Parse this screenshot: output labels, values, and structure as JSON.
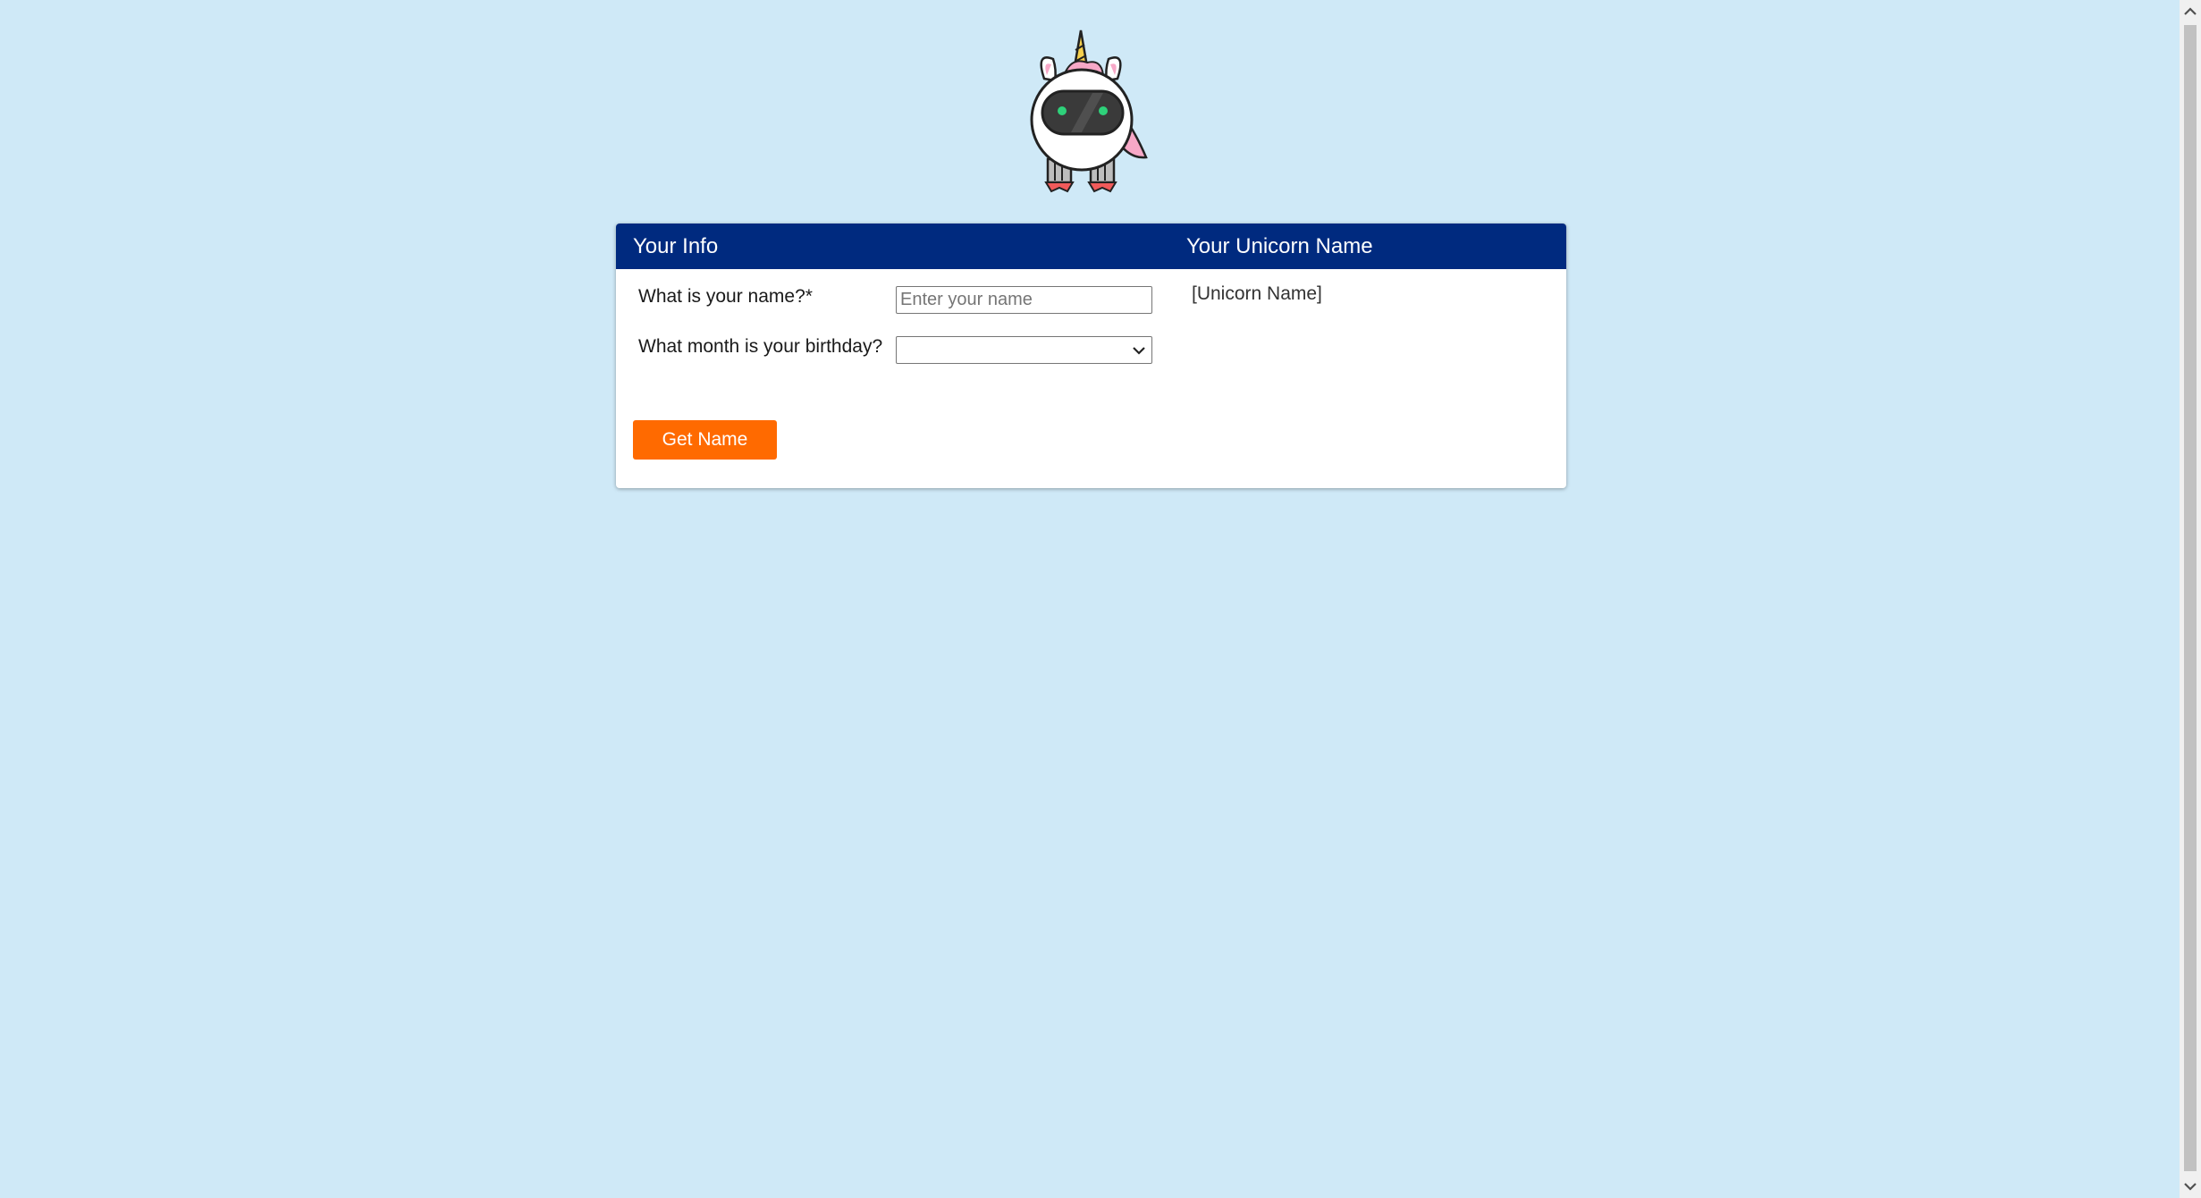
{
  "header": {
    "left_title": "Your Info",
    "right_title": "Your Unicorn Name"
  },
  "form": {
    "name_label": "What is your name?*",
    "name_placeholder": "Enter your name",
    "name_value": "",
    "month_label": "What month is your birthday?",
    "month_selected": ""
  },
  "result": {
    "unicorn_name": "[Unicorn Name]"
  },
  "actions": {
    "get_name_label": "Get Name"
  },
  "colors": {
    "background": "#cfe9f7",
    "header": "#002a7f",
    "button": "#ff6a00"
  },
  "icons": {
    "logo": "unicorn-astronaut-logo",
    "select": "chevron-down-icon",
    "scroll_up": "scroll-up-icon",
    "scroll_down": "scroll-down-icon"
  }
}
